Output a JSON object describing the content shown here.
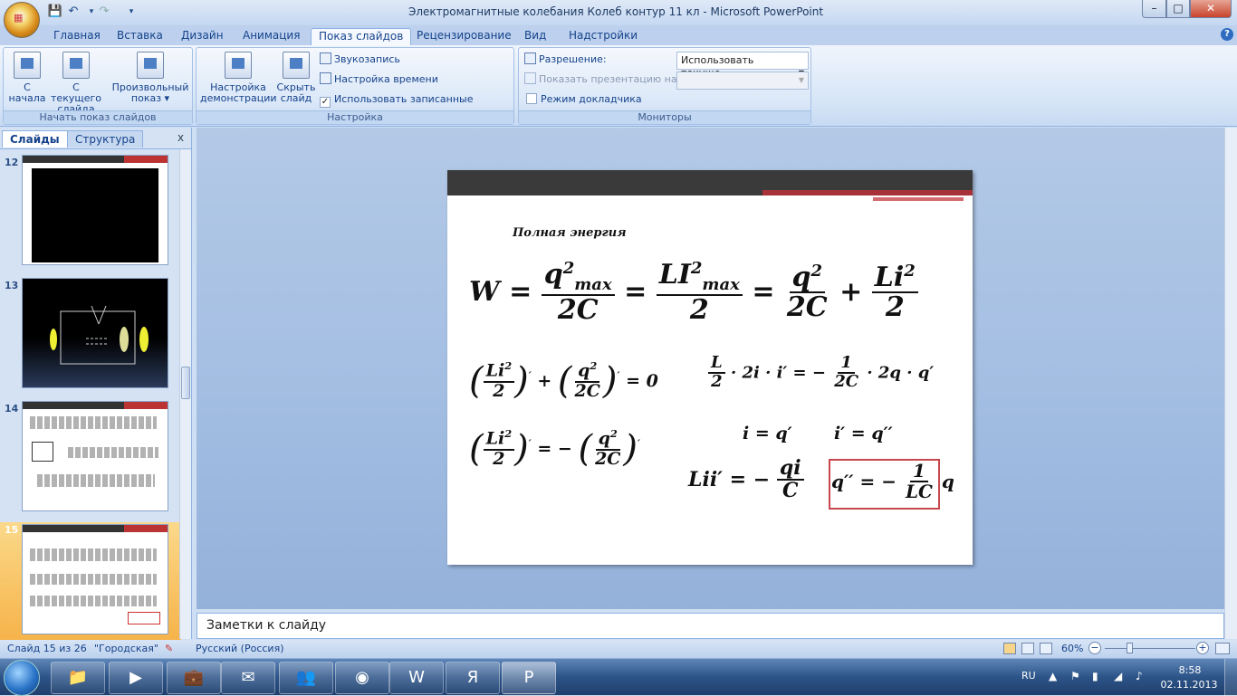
{
  "window": {
    "title": "Электромагнитные колебания Колеб контур 11 кл - Microsoft PowerPoint",
    "min": "–",
    "max": "□",
    "close": "✕"
  },
  "ribbon_tabs": [
    "Главная",
    "Вставка",
    "Дизайн",
    "Анимация",
    "Показ слайдов",
    "Рецензирование",
    "Вид",
    "Надстройки"
  ],
  "ribbon": {
    "start_group": {
      "label": "Начать показ слайдов",
      "from_start": "С\nначала",
      "from_current": "С текущего\nслайда",
      "custom": "Произвольный\nпоказ ▾"
    },
    "setup_group": {
      "label": "Настройка",
      "setup_show": "Настройка\nдемонстрации",
      "hide_slide": "Скрыть\nслайд",
      "record_narration": "Звукозапись",
      "rehearse": "Настройка времени",
      "use_timings": "Использовать записанные времена"
    },
    "monitors_group": {
      "label": "Мониторы",
      "resolution_label": "Разрешение:",
      "resolution_value": "Использовать текуще...",
      "show_on_label": "Показать презентацию на:",
      "presenter_view": "Режим докладчика"
    }
  },
  "left_pane": {
    "tab_slides": "Слайды",
    "tab_outline": "Структура",
    "close": "x",
    "slides": [
      "12",
      "13",
      "14",
      "15"
    ]
  },
  "slide": {
    "heading": "Полная энергия"
  },
  "notes_placeholder": "Заметки к слайду",
  "status": {
    "slide_info": "Слайд 15 из 26",
    "theme": "\"Городская\"",
    "language": "Русский (Россия)",
    "zoom": "60%"
  },
  "taskbar": {
    "lang": "RU",
    "time": "8:58",
    "date": "02.11.2013"
  }
}
